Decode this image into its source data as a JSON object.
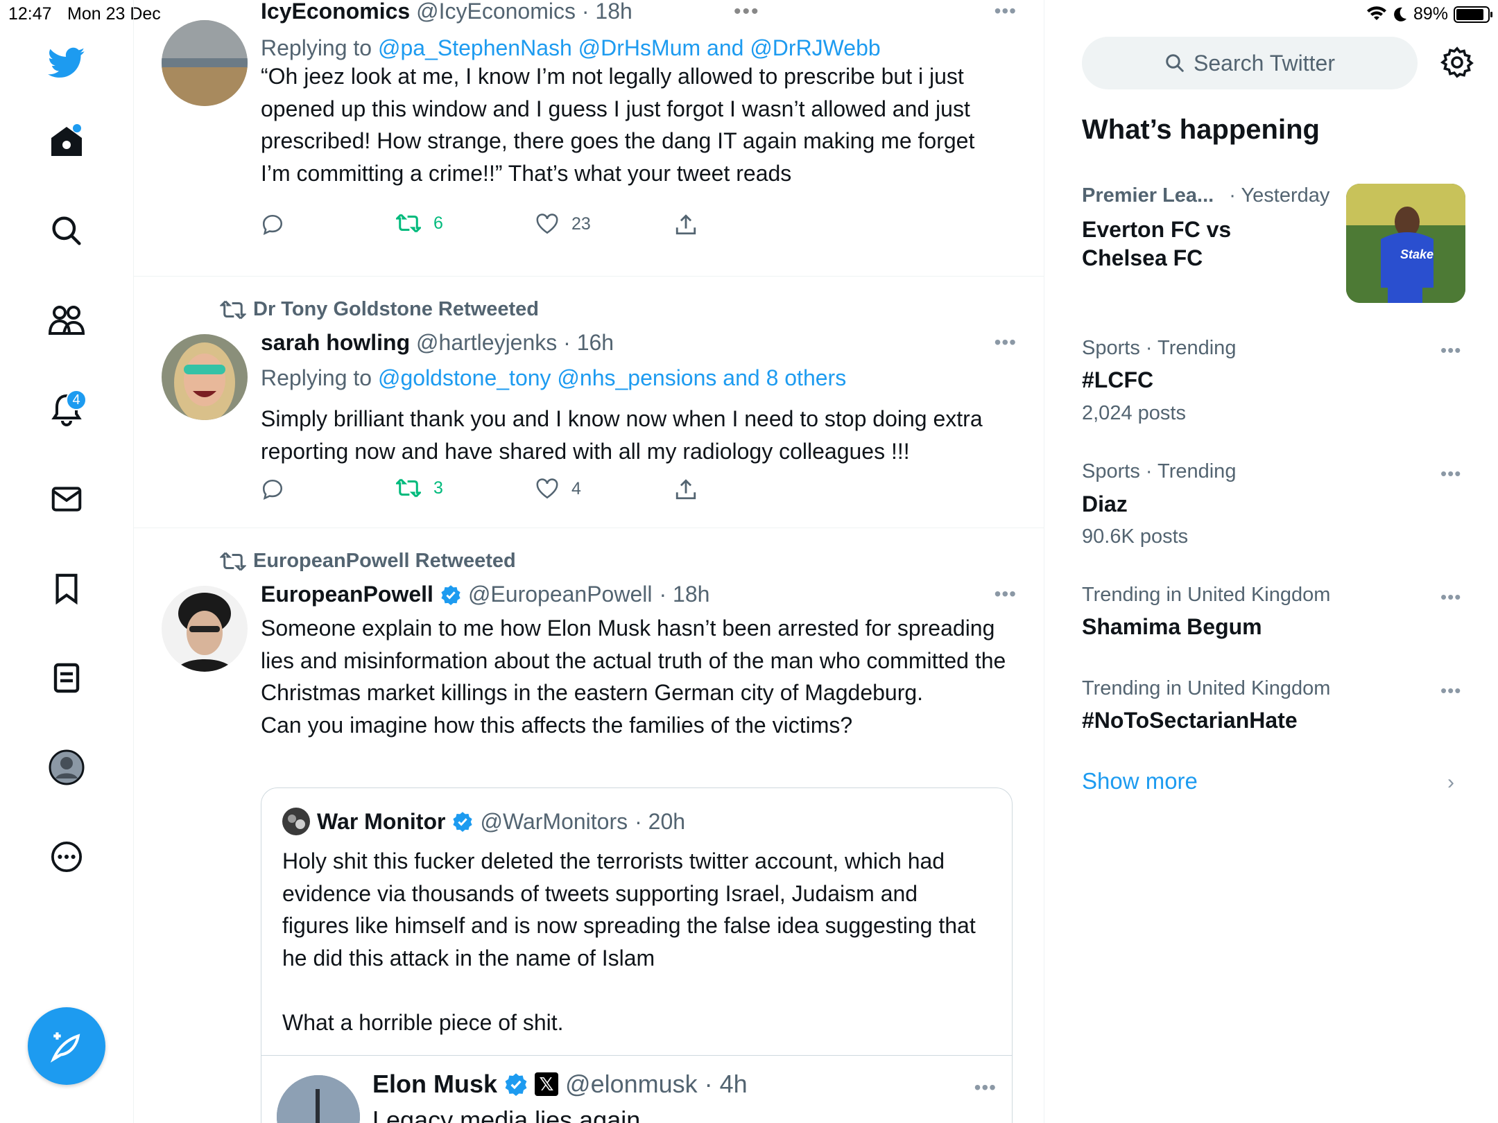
{
  "status_bar": {
    "time": "12:47",
    "date": "Mon 23 Dec",
    "dots": "•••",
    "battery": "89%",
    "battery_level": 0.89
  },
  "nav": {
    "notifications_badge": "4"
  },
  "tweets": [
    {
      "name": "IcyEconomics",
      "handle": "@IcyEconomics",
      "time": "· 18h",
      "replying_prefix": "Replying to ",
      "replying_to": "@pa_StephenNash @DrHsMum and @DrRJWebb",
      "body": "“Oh jeez look at me, I know I’m not legally allowed to prescribe but i just opened up this window and I guess I just forgot I wasn’t allowed and just prescribed! How strange, there goes the dang IT again making me forget I’m committing a crime!!” That’s what your tweet reads",
      "retweets": "6",
      "likes": "23"
    },
    {
      "retweeted_by": "Dr Tony Goldstone Retweeted",
      "name": "sarah howling",
      "handle": "@hartleyjenks",
      "time": "· 16h",
      "replying_prefix": "Replying to ",
      "replying_to": "@goldstone_tony @nhs_pensions and 8 others",
      "body": "Simply brilliant thank you and I know now when I need to stop doing extra reporting now and have shared with all my radiology colleagues !!!",
      "retweets": "3",
      "likes": "4"
    },
    {
      "retweeted_by": "EuropeanPowell Retweeted",
      "name": "EuropeanPowell",
      "handle": "@EuropeanPowell",
      "time": "· 18h",
      "body": "Someone explain to me how Elon Musk hasn’t been arrested for spreading lies and misinformation about the actual truth of the man who committed the Christmas market killings in the eastern German city of Magdeburg.\nCan you imagine how this affects the families of the victims?",
      "quote": {
        "name": "War Monitor",
        "handle": "@WarMonitors",
        "time": "· 20h",
        "body": "Holy shit this fucker deleted the terrorists twitter account, which had evidence via thousands of tweets supporting Israel, Judaism and figures like himself and is now spreading the false idea suggesting that he did this attack in the name of Islam\n\nWhat a horrible piece of shit.",
        "inner": {
          "name": "Elon Musk",
          "handle": "@elonmusk",
          "time": "· 4h",
          "body": "Legacy media lies again"
        }
      }
    }
  ],
  "sidebar": {
    "search_placeholder": "Search Twitter",
    "whats_happening": "What’s happening",
    "trends": [
      {
        "category": "Premier Lea...",
        "time": "· Yesterday",
        "name": "Everton FC vs Chelsea FC"
      },
      {
        "category": "Sports · Trending",
        "name": "#LCFC",
        "count": "2,024 posts"
      },
      {
        "category": "Sports · Trending",
        "name": "Diaz",
        "count": "90.6K posts"
      },
      {
        "category": "Trending in United Kingdom",
        "name": "Shamima Begum"
      },
      {
        "category": "Trending in United Kingdom",
        "name": "#NoToSectarianHate"
      }
    ],
    "show_more": "Show more",
    "image_text": "Stake"
  },
  "colors": {
    "accent": "#1d9bf0",
    "retweet_green": "#00ba7c",
    "secondary_text": "#536471"
  }
}
